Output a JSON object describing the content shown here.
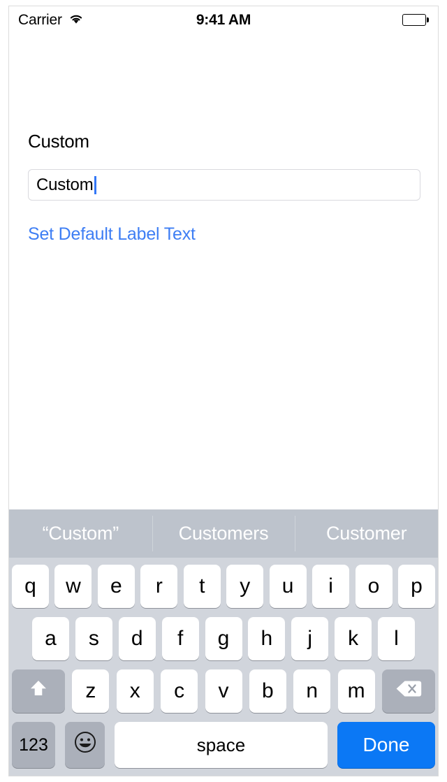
{
  "status_bar": {
    "carrier": "Carrier",
    "wifi_icon": "wifi-icon",
    "time": "9:41 AM",
    "battery_icon": "battery-full-icon"
  },
  "content": {
    "section_label": "Custom",
    "text_field": {
      "value": "Custom",
      "placeholder": "Custom"
    },
    "default_link_label": "Set Default Label Text"
  },
  "keyboard": {
    "suggestions": [
      "“Custom”",
      "Customers",
      "Customer"
    ],
    "row1": [
      "q",
      "w",
      "e",
      "r",
      "t",
      "y",
      "u",
      "i",
      "o",
      "p"
    ],
    "row2": [
      "a",
      "s",
      "d",
      "f",
      "g",
      "h",
      "j",
      "k",
      "l"
    ],
    "row3": [
      "z",
      "x",
      "c",
      "v",
      "b",
      "n",
      "m"
    ],
    "shift_icon": "shift-icon",
    "backspace_icon": "backspace-icon",
    "numeric_label": "123",
    "emoji_icon": "emoji-icon",
    "space_label": "space",
    "return_label": "Done"
  },
  "colors": {
    "accent_blue": "#0b78f5",
    "link_blue": "#3e7ef4",
    "caret_blue": "#3478f6",
    "suggestion_bar_bg": "#bdc3cc",
    "keyboard_bg": "#d1d5dc",
    "dark_key_bg": "#abb0ba"
  }
}
